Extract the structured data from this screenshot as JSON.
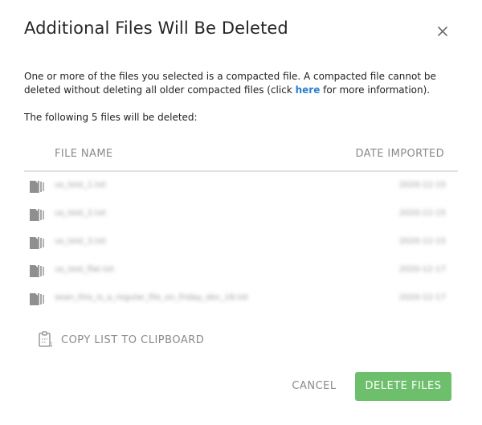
{
  "dialog": {
    "title": "Additional Files Will Be Deleted",
    "description_before_link": "One or more of the files you selected is a compacted file. A compacted file cannot be deleted without deleting all older compacted files (click ",
    "link_text": "here",
    "description_after_link": " for more information).",
    "count_text": "The following 5 files will be deleted:"
  },
  "table": {
    "columns": [
      "FILE NAME",
      "DATE IMPORTED"
    ],
    "rows": [
      {
        "name": "us_test_1.txt",
        "date": "2020-12-15"
      },
      {
        "name": "us_test_2.txt",
        "date": "2020-12-15"
      },
      {
        "name": "us_test_3.txt",
        "date": "2020-12-15"
      },
      {
        "name": "us_test_flat.txt",
        "date": "2020-12-17"
      },
      {
        "name": "sean_this_is_a_regular_file_on_friday_dec_18.txt",
        "date": "2020-12-17"
      }
    ]
  },
  "actions": {
    "copy_label": "COPY LIST TO CLIPBOARD",
    "cancel_label": "CANCEL",
    "delete_label": "DELETE FILES"
  },
  "icons": {
    "close": "close-icon",
    "file": "compacted-file-icon",
    "clipboard": "clipboard-icon"
  },
  "colors": {
    "link": "#2a7fd1",
    "primary_button": "#6dbf6b",
    "muted_text": "#8a8a8a"
  }
}
